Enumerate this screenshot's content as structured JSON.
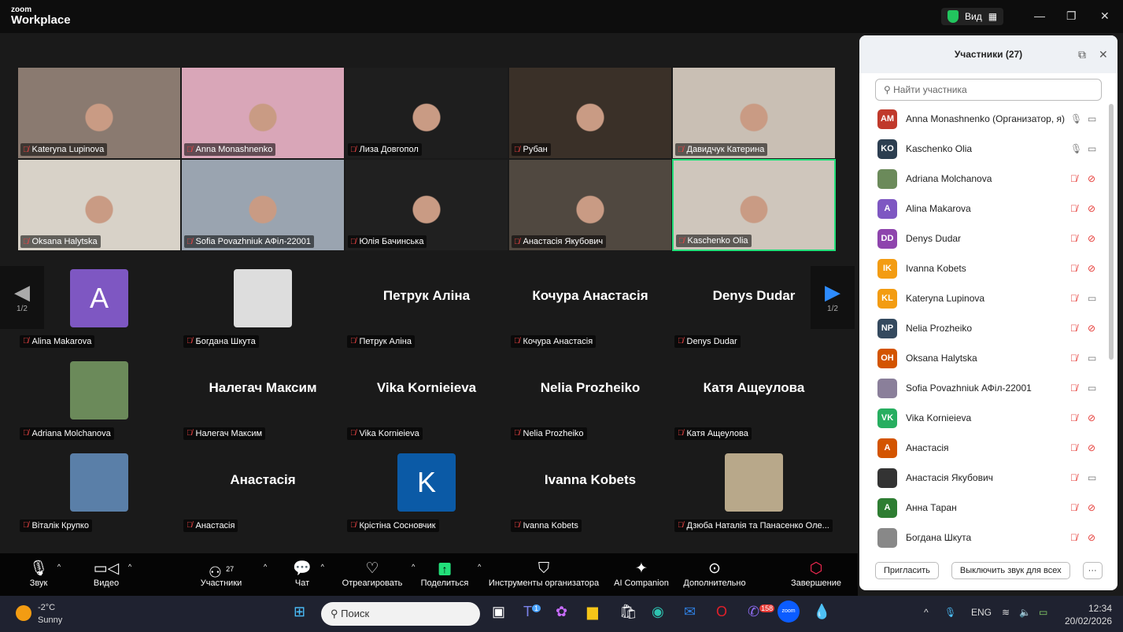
{
  "app": {
    "logo_small": "zoom",
    "logo_big": "Workplace",
    "view_label": "Вид"
  },
  "video_tiles": [
    {
      "name": "Kateryna Lupinova",
      "bg": "#8a7a70"
    },
    {
      "name": "Anna Monashnenko",
      "bg": "#d9a6b8"
    },
    {
      "name": "Лиза Довгопол",
      "bg": "#1e1e1e"
    },
    {
      "name": "Рубан",
      "bg": "#3a3028"
    },
    {
      "name": "Давидчук Катерина",
      "bg": "#c9bfb4"
    },
    {
      "name": "Oksana Halytska",
      "bg": "#d8d2c8"
    },
    {
      "name": "Sofia Povazhniuk АФіл-22001",
      "bg": "#9aa4b0"
    },
    {
      "name": "Юлія Бачинська",
      "bg": "#202020"
    },
    {
      "name": "Анастасія Якубович",
      "bg": "#504840"
    },
    {
      "name": "Kaschenko Olia",
      "bg": "#cfc6bc"
    }
  ],
  "gallery_tiles": [
    {
      "big": "",
      "avatar": "A",
      "avatar_color": "#7e57c2",
      "name": "Alina Makarova"
    },
    {
      "big": "",
      "avatar": "",
      "avatar_color": "#ddd",
      "name": "Богдана Шкута"
    },
    {
      "big": "Петрук Аліна",
      "name": "Петрук Аліна"
    },
    {
      "big": "Кочура Анастасія",
      "name": "Кочура Анастасія"
    },
    {
      "big": "Denys Dudar",
      "name": "Denys Dudar"
    },
    {
      "big": "",
      "avatar": "",
      "avatar_color": "#6b8a5a",
      "name": "Adriana Molchanova"
    },
    {
      "big": "Налегач Максим",
      "name": "Налегач Максим"
    },
    {
      "big": "Vika Kornieieva",
      "name": "Vika Kornieieva"
    },
    {
      "big": "Nelia Prozheiko",
      "name": "Nelia Prozheiko"
    },
    {
      "big": "Катя Ащеулова",
      "name": "Катя Ащеулова"
    },
    {
      "big": "",
      "avatar": "",
      "avatar_color": "#5a7fa8",
      "name": "Віталік Крупко"
    },
    {
      "big": "Анастасія",
      "name": "Анастасія"
    },
    {
      "big": "",
      "avatar": "K",
      "avatar_color": "#0b5aa6",
      "name": "Крістіна Сосновчик"
    },
    {
      "big": "Ivanna Kobets",
      "name": "Ivanna Kobets"
    },
    {
      "big": "",
      "avatar": "",
      "avatar_color": "#b8a88a",
      "name": "Дзюба Наталія та Панасенко Оле..."
    }
  ],
  "pager": {
    "left": "1/2",
    "right": "1/2"
  },
  "toolbar": {
    "audio": "Звук",
    "video": "Видео",
    "participants": "Участники",
    "participants_count": "27",
    "chat": "Чат",
    "react": "Отреагировать",
    "share": "Поделиться",
    "host_tools": "Инструменты организатора",
    "ai": "AI Companion",
    "more": "Дополнительно",
    "end": "Завершение"
  },
  "panel": {
    "title": "Участники (27)",
    "search_placeholder": "Найти участника",
    "participants": [
      {
        "initials": "AM",
        "color": "#c0392b",
        "name": "Anna Monashnenko (Организатор, я)",
        "muted": false,
        "cam_off": false
      },
      {
        "initials": "KO",
        "color": "#2c3e50",
        "name": "Kaschenko Olia",
        "muted": false,
        "cam_off": false
      },
      {
        "initials": "",
        "color": "#6b8a5a",
        "name": "Adriana Molchanova",
        "muted": true,
        "cam_off": true
      },
      {
        "initials": "A",
        "color": "#7e57c2",
        "name": "Alina Makarova",
        "muted": true,
        "cam_off": true
      },
      {
        "initials": "DD",
        "color": "#8e44ad",
        "name": "Denys Dudar",
        "muted": true,
        "cam_off": true
      },
      {
        "initials": "IK",
        "color": "#f39c12",
        "name": "Ivanna Kobets",
        "muted": true,
        "cam_off": true
      },
      {
        "initials": "KL",
        "color": "#f39c12",
        "name": "Kateryna Lupinova",
        "muted": true,
        "cam_off": false
      },
      {
        "initials": "NP",
        "color": "#34495e",
        "name": "Nelia Prozheiko",
        "muted": true,
        "cam_off": true
      },
      {
        "initials": "OH",
        "color": "#d35400",
        "name": "Oksana Halytska",
        "muted": true,
        "cam_off": false
      },
      {
        "initials": "",
        "color": "#8a7f9a",
        "name": "Sofia Povazhniuk АФіл-22001",
        "muted": true,
        "cam_off": false
      },
      {
        "initials": "VK",
        "color": "#27ae60",
        "name": "Vika Kornieieva",
        "muted": true,
        "cam_off": true
      },
      {
        "initials": "A",
        "color": "#d35400",
        "name": "Анастасія",
        "muted": true,
        "cam_off": true
      },
      {
        "initials": "",
        "color": "#333",
        "name": "Анастасія Якубович",
        "muted": true,
        "cam_off": false
      },
      {
        "initials": "A",
        "color": "#2e7d32",
        "name": "Анна Таран",
        "muted": true,
        "cam_off": true
      },
      {
        "initials": "",
        "color": "#888",
        "name": "Богдана Шкута",
        "muted": true,
        "cam_off": true
      }
    ],
    "invite": "Пригласить",
    "mute_all": "Выключить звук для всех",
    "more": "···"
  },
  "taskbar": {
    "temp": "-2°C",
    "weather": "Sunny",
    "search": "Поиск",
    "teams_badge": "1",
    "viber_badge": "158",
    "lang": "ENG",
    "time": "12:34",
    "date": "20/02/2026"
  }
}
